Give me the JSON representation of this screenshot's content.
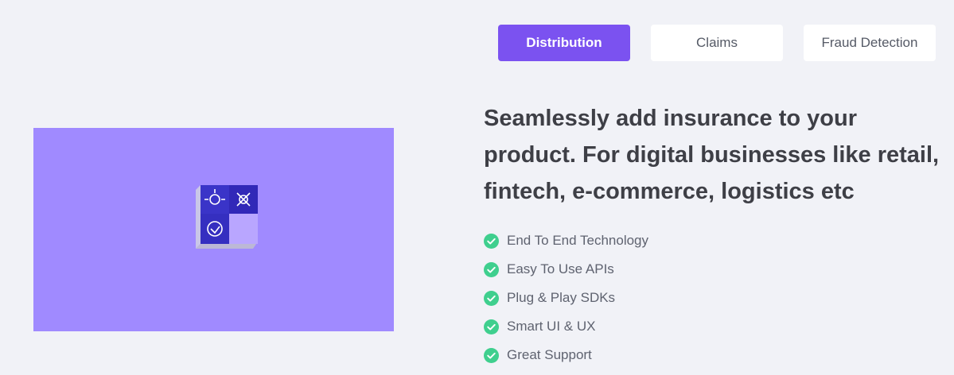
{
  "tabs": [
    {
      "label": "Distribution",
      "active": true
    },
    {
      "label": "Claims",
      "active": false
    },
    {
      "label": "Fraud Detection",
      "active": false
    }
  ],
  "heading": "Seamlessly add insurance to your product. For digital businesses like retail, fintech, e-commerce, logistics etc",
  "features": [
    {
      "label": "End To End Technology",
      "icon": "check-circle-icon"
    },
    {
      "label": "Easy To Use APIs",
      "icon": "check-circle-icon"
    },
    {
      "label": "Plug & Play SDKs",
      "icon": "check-circle-icon"
    },
    {
      "label": "Smart UI & UX",
      "icon": "check-circle-icon"
    },
    {
      "label": "Great Support",
      "icon": "check-circle-icon"
    }
  ],
  "colors": {
    "background": "#f1f2f7",
    "accent": "#7b52f0",
    "media_background": "#a08aff",
    "check": "#3fcf8e",
    "heading": "#3e3f46"
  }
}
